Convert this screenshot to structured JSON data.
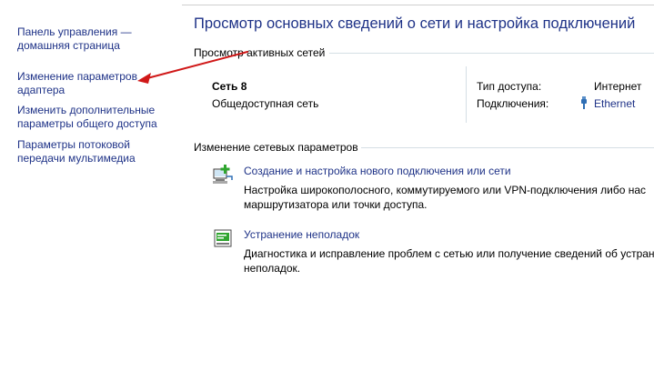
{
  "sidebar": {
    "items": [
      {
        "lines": [
          "Панель управления —",
          "домашняя страница"
        ]
      },
      {
        "lines": [
          "Изменение параметров",
          "адаптера"
        ]
      },
      {
        "lines": [
          "Изменить дополнительные",
          "параметры общего доступа"
        ]
      },
      {
        "lines": [
          "Параметры потоковой",
          "передачи мультимедиа"
        ]
      }
    ]
  },
  "main": {
    "title": "Просмотр основных сведений о сети и настройка подключений",
    "active_networks": {
      "header": "Просмотр активных сетей",
      "network_name": "Сеть 8",
      "network_type": "Общедоступная сеть",
      "access_type_label": "Тип доступа:",
      "access_type_value": "Интернет",
      "connections_label": "Подключения:",
      "connections_value": "Ethernet"
    },
    "change_settings": {
      "header": "Изменение сетевых параметров",
      "tasks": [
        {
          "icon": "network-setup-icon",
          "link": "Создание и настройка нового подключения или сети",
          "desc_lines": [
            "Настройка широкополосного, коммутируемого или VPN-подключения либо нас",
            "маршрутизатора или точки доступа."
          ]
        },
        {
          "icon": "troubleshoot-icon",
          "link": "Устранение неполадок",
          "desc_lines": [
            "Диагностика и исправление проблем с сетью или получение сведений об устран",
            "неполадок."
          ]
        }
      ]
    }
  },
  "colors": {
    "link": "#1e3287",
    "annotation_arrow": "#d01818"
  }
}
